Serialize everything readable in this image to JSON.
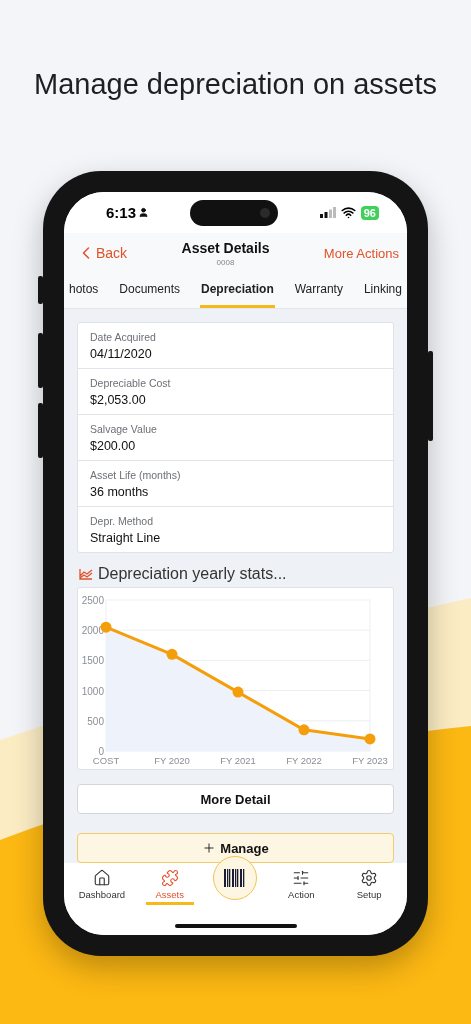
{
  "headline": "Manage depreciation on assets",
  "status_bar": {
    "time": "6:13",
    "battery": "96"
  },
  "header": {
    "back": "Back",
    "title": "Asset Details",
    "subtitle": "0008",
    "action": "More Actions"
  },
  "tabs": [
    {
      "label": "hotos",
      "selected": false
    },
    {
      "label": "Documents",
      "selected": false
    },
    {
      "label": "Depreciation",
      "selected": true
    },
    {
      "label": "Warranty",
      "selected": false
    },
    {
      "label": "Linking",
      "selected": false
    }
  ],
  "fields": [
    {
      "label": "Date Acquired",
      "value": "04/11/2020"
    },
    {
      "label": "Depreciable Cost",
      "value": "$2,053.00"
    },
    {
      "label": "Salvage Value",
      "value": "$200.00"
    },
    {
      "label": "Asset Life (months)",
      "value": "36 months"
    },
    {
      "label": "Depr. Method",
      "value": "Straight Line"
    }
  ],
  "chart_section": {
    "title": "Depreciation yearly stats...",
    "chart_data": {
      "type": "line",
      "categories": [
        "COST",
        "FY 2020",
        "FY 2021",
        "FY 2022",
        "FY 2023"
      ],
      "series": [
        {
          "color": "#f59e0b",
          "marker": true,
          "values": [
            2050,
            1600,
            975,
            350,
            200
          ]
        }
      ],
      "grid": true,
      "ylim": [
        0,
        2500
      ],
      "yticks": [
        0,
        500,
        1000,
        1500,
        2000,
        2500
      ]
    }
  },
  "buttons": [
    {
      "kind": "plain",
      "label": "More Detail"
    },
    {
      "kind": "accent",
      "label": "Manage"
    }
  ],
  "nav": [
    {
      "kind": "home",
      "label": "Dashboard",
      "selected": false
    },
    {
      "kind": "assets",
      "label": "Assets",
      "selected": true
    },
    {
      "kind": "scan"
    },
    {
      "kind": "action",
      "label": "Action",
      "selected": false
    },
    {
      "kind": "setup",
      "label": "Setup",
      "selected": false
    }
  ]
}
